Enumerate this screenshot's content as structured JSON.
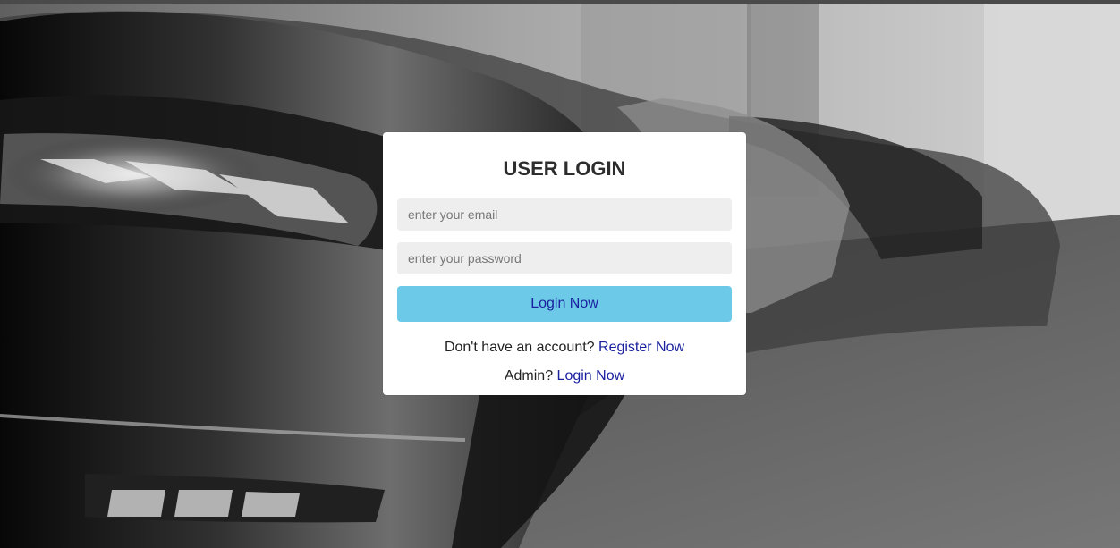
{
  "login": {
    "title": "USER LOGIN",
    "email_placeholder": "enter your email",
    "password_placeholder": "enter your password",
    "submit_label": "Login Now",
    "register_prompt": "Don't have an account?",
    "register_link": "Register Now",
    "admin_prompt": "Admin?",
    "admin_link": "Login Now"
  },
  "colors": {
    "card_background": "#ffffff",
    "input_background": "#eeeeee",
    "button_background": "#6ccae8",
    "link_text": "#1a219f",
    "title_text": "#2d2d2d"
  },
  "background": {
    "description": "grayscale parked cars"
  }
}
